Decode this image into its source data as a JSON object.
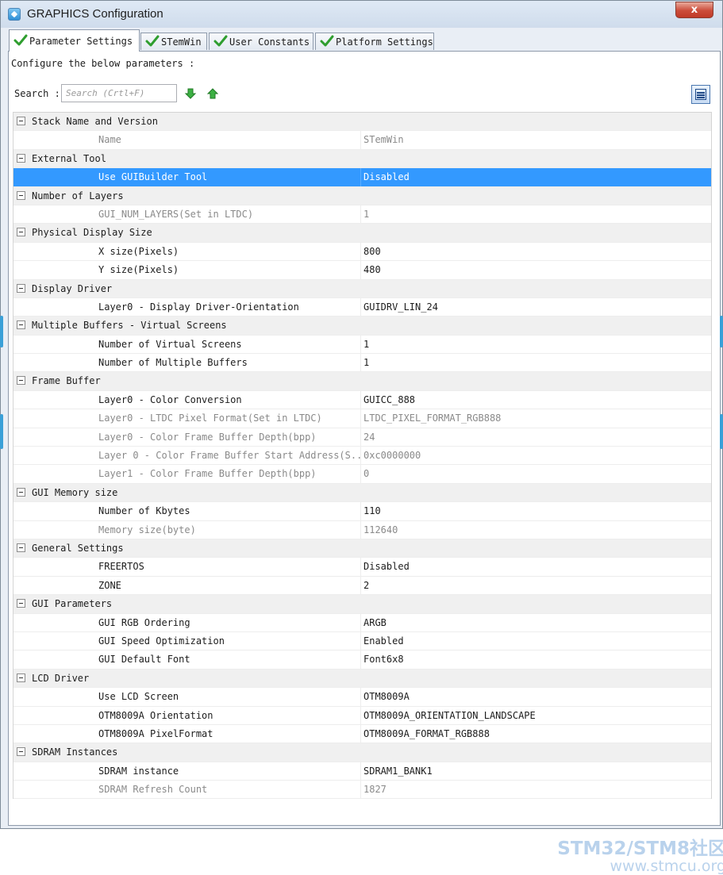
{
  "window": {
    "title": "GRAPHICS Configuration",
    "close_label": "x"
  },
  "tabs": [
    {
      "label": "Parameter Settings",
      "active": true
    },
    {
      "label": "STemWin",
      "active": false
    },
    {
      "label": "User Constants",
      "active": false
    },
    {
      "label": "Platform Settings",
      "active": false
    }
  ],
  "configure_text": "Configure the below parameters :",
  "search": {
    "label": "Search :",
    "placeholder": "Search (Crtl+F)"
  },
  "colors": {
    "selection": "#3399ff",
    "group_bg": "#f0f0f0",
    "readonly_text": "#8a8a8a",
    "check_green": "#2f9e2f"
  },
  "groups": [
    {
      "label": "Stack Name and Version",
      "params": [
        {
          "name": "Name",
          "value": "STemWin",
          "readonly": true
        }
      ]
    },
    {
      "label": "External Tool",
      "params": [
        {
          "name": "Use GUIBuilder Tool",
          "value": "Disabled",
          "selected": true
        }
      ]
    },
    {
      "label": "Number of Layers",
      "params": [
        {
          "name": "GUI_NUM_LAYERS(Set in LTDC)",
          "value": "1",
          "readonly": true
        }
      ]
    },
    {
      "label": "Physical Display Size",
      "params": [
        {
          "name": "X size(Pixels)",
          "value": "800"
        },
        {
          "name": "Y size(Pixels)",
          "value": "480"
        }
      ]
    },
    {
      "label": "Display Driver",
      "params": [
        {
          "name": "Layer0 - Display Driver-Orientation",
          "value": "GUIDRV_LIN_24"
        }
      ]
    },
    {
      "label": "Multiple Buffers - Virtual Screens",
      "params": [
        {
          "name": "Number of Virtual Screens",
          "value": "1"
        },
        {
          "name": "Number of Multiple Buffers",
          "value": "1"
        }
      ]
    },
    {
      "label": "Frame Buffer",
      "params": [
        {
          "name": "Layer0 - Color Conversion",
          "value": "GUICC_888"
        },
        {
          "name": "Layer0 - LTDC Pixel Format(Set in LTDC)",
          "value": "LTDC_PIXEL_FORMAT_RGB888",
          "readonly": true
        },
        {
          "name": "Layer0 - Color Frame Buffer Depth(bpp)",
          "value": "24",
          "readonly": true
        },
        {
          "name": "Layer 0 - Color Frame Buffer Start Address(S...",
          "value": "0xc0000000",
          "readonly": true
        },
        {
          "name": "Layer1 - Color Frame Buffer Depth(bpp)",
          "value": "0",
          "readonly": true
        }
      ]
    },
    {
      "label": "GUI Memory size",
      "params": [
        {
          "name": "Number of Kbytes",
          "value": "110"
        },
        {
          "name": "Memory size(byte)",
          "value": "112640",
          "readonly": true
        }
      ]
    },
    {
      "label": "General Settings",
      "params": [
        {
          "name": "FREERTOS",
          "value": "Disabled"
        },
        {
          "name": "ZONE",
          "value": "2"
        }
      ]
    },
    {
      "label": "GUI Parameters",
      "params": [
        {
          "name": "GUI RGB Ordering",
          "value": "ARGB"
        },
        {
          "name": "GUI Speed Optimization",
          "value": "Enabled"
        },
        {
          "name": "GUI Default Font",
          "value": "Font6x8"
        }
      ]
    },
    {
      "label": "LCD Driver",
      "params": [
        {
          "name": "Use LCD Screen",
          "value": "OTM8009A"
        },
        {
          "name": "OTM8009A Orientation",
          "value": "OTM8009A_ORIENTATION_LANDSCAPE"
        },
        {
          "name": "OTM8009A PixelFormat",
          "value": "OTM8009A_FORMAT_RGB888"
        }
      ]
    },
    {
      "label": "SDRAM Instances",
      "params": [
        {
          "name": "SDRAM instance",
          "value": "SDRAM1_BANK1"
        },
        {
          "name": "SDRAM Refresh Count",
          "value": "1827",
          "readonly": true
        }
      ]
    }
  ],
  "watermark": {
    "line1": "STM32/STM8社区",
    "line2": "www.stmcu.org"
  }
}
